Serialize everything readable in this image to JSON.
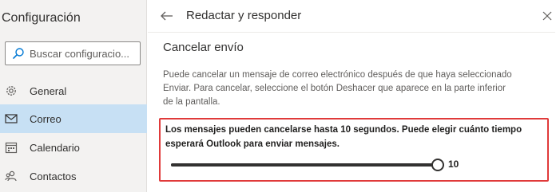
{
  "sidebar": {
    "title": "Configuración",
    "search_placeholder": "Buscar configuracio...",
    "items": [
      {
        "label": "General",
        "active": false
      },
      {
        "label": "Correo",
        "active": true
      },
      {
        "label": "Calendario",
        "active": false
      },
      {
        "label": "Contactos",
        "active": false
      }
    ]
  },
  "panel": {
    "title": "Redactar y responder",
    "section_title": "Cancelar envío",
    "description": "Puede cancelar un mensaje de correo electrónico después de que haya seleccionado Enviar. Para cancelar, seleccione el botón Deshacer que aparece en la parte inferior de la pantalla.",
    "highlight_text": "Los mensajes pueden cancelarse hasta 10 segundos. Puede elegir cuánto tiempo esperará Outlook para enviar mensajes.",
    "slider": {
      "value": 10,
      "min": 0,
      "max": 10,
      "value_label": "10"
    }
  },
  "colors": {
    "accent_selected": "#c7e0f4",
    "highlight_border": "#e03a3a",
    "sidebar_bg": "#f3f2f1"
  },
  "icons": {
    "search": "search-icon",
    "general": "gear-icon",
    "mail": "mail-icon",
    "calendar": "calendar-icon",
    "contacts": "people-icon",
    "back": "back-arrow-icon",
    "close": "close-icon"
  }
}
